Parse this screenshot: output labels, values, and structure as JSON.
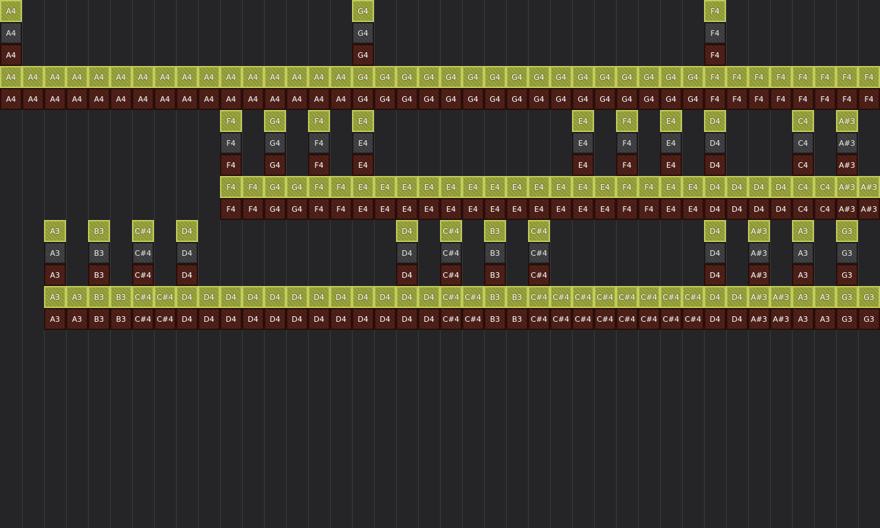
{
  "colors": {
    "background": "#252527",
    "grid_line": "#3a3a3c",
    "olive": "#96a037",
    "gray": "#3b3b3e",
    "red": "#4a1c14"
  },
  "blocks": [
    {
      "label": "block-1",
      "start": 0,
      "single_row": 0,
      "run_row": 3,
      "headers": [
        [
          0,
          "A4"
        ],
        [
          16,
          "G4"
        ],
        [
          32,
          "F4"
        ]
      ],
      "run": [
        "A4",
        "A4",
        "A4",
        "A4",
        "A4",
        "A4",
        "A4",
        "A4",
        "A4",
        "A4",
        "A4",
        "A4",
        "A4",
        "A4",
        "A4",
        "A4",
        "G4",
        "G4",
        "G4",
        "G4",
        "G4",
        "G4",
        "G4",
        "G4",
        "G4",
        "G4",
        "G4",
        "G4",
        "G4",
        "G4",
        "G4",
        "G4",
        "F4",
        "F4",
        "F4",
        "F4",
        "F4",
        "F4",
        "F4",
        "F4"
      ]
    },
    {
      "label": "block-2",
      "start": 10,
      "single_row": 5,
      "run_row": 8,
      "headers": [
        [
          10,
          "F4"
        ],
        [
          12,
          "G4"
        ],
        [
          14,
          "F4"
        ],
        [
          16,
          "E4"
        ],
        [
          26,
          "E4"
        ],
        [
          28,
          "F4"
        ],
        [
          30,
          "E4"
        ],
        [
          32,
          "D4"
        ],
        [
          36,
          "C4"
        ],
        [
          38,
          "A#3"
        ]
      ],
      "run": [
        "F4",
        "F4",
        "G4",
        "G4",
        "F4",
        "F4",
        "E4",
        "E4",
        "E4",
        "E4",
        "E4",
        "E4",
        "E4",
        "E4",
        "E4",
        "E4",
        "E4",
        "E4",
        "F4",
        "F4",
        "E4",
        "E4",
        "D4",
        "D4",
        "D4",
        "D4",
        "C4",
        "C4",
        "A#3",
        "A#3"
      ]
    },
    {
      "label": "block-3",
      "start": 2,
      "single_row": 10,
      "run_row": 13,
      "headers": [
        [
          2,
          "A3"
        ],
        [
          4,
          "B3"
        ],
        [
          6,
          "C#4"
        ],
        [
          8,
          "D4"
        ],
        [
          18,
          "D4"
        ],
        [
          20,
          "C#4"
        ],
        [
          22,
          "B3"
        ],
        [
          24,
          "C#4"
        ],
        [
          32,
          "D4"
        ],
        [
          34,
          "A#3"
        ],
        [
          36,
          "A3"
        ],
        [
          38,
          "G3"
        ]
      ],
      "run": [
        "A3",
        "A3",
        "B3",
        "B3",
        "C#4",
        "C#4",
        "D4",
        "D4",
        "D4",
        "D4",
        "D4",
        "D4",
        "D4",
        "D4",
        "D4",
        "D4",
        "D4",
        "D4",
        "C#4",
        "C#4",
        "B3",
        "B3",
        "C#4",
        "C#4",
        "C#4",
        "C#4",
        "C#4",
        "C#4",
        "C#4",
        "C#4",
        "D4",
        "D4",
        "A#3",
        "A#3",
        "A3",
        "A3",
        "G3",
        "G3"
      ]
    }
  ]
}
